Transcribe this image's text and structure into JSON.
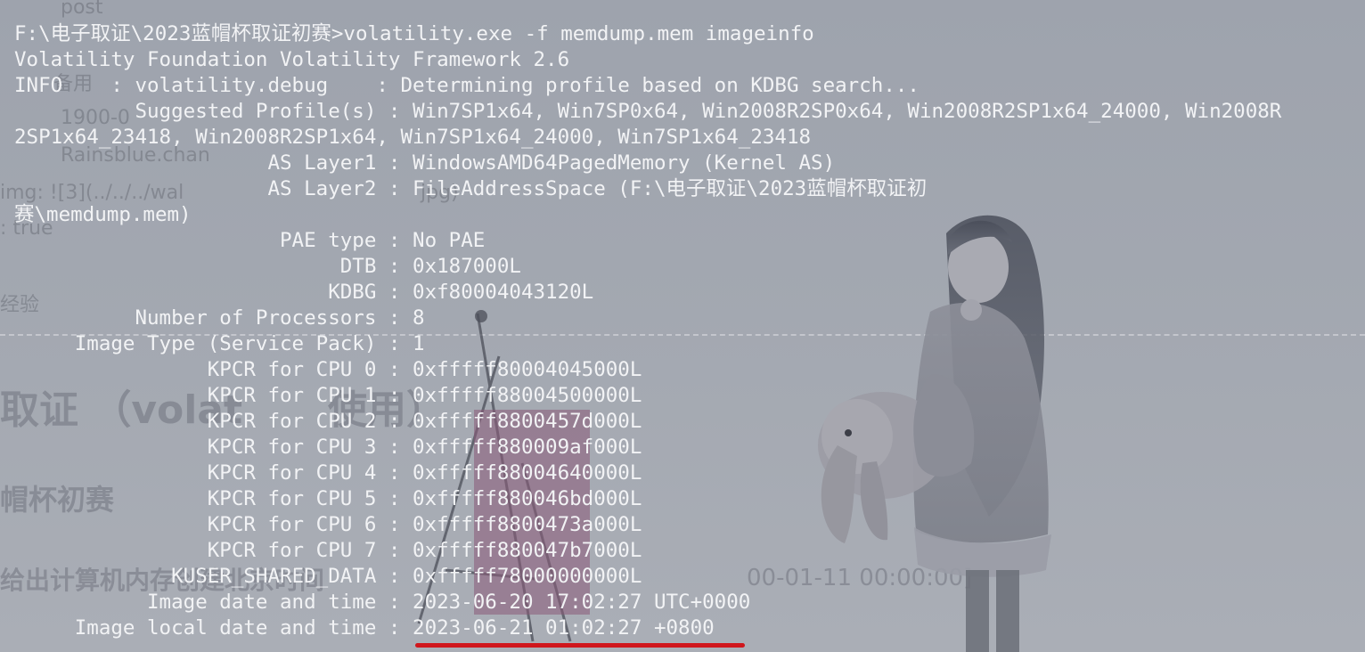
{
  "background": {
    "ghost_texts": [
      {
        "id": "post",
        "text": "post"
      },
      {
        "id": "cat",
        "text": "备用"
      },
      {
        "id": "date",
        "text": "1900-0"
      },
      {
        "id": "author",
        "text": "Rainsblue.chan"
      },
      {
        "id": "img",
        "text": "img: ![3](../../../wal"
      },
      {
        "id": "jpg",
        "text": "jpg)"
      },
      {
        "id": "bool",
        "text": ": true"
      },
      {
        "id": "exp",
        "text": "经验"
      },
      {
        "id": "heading1",
        "text": "取证 （volat"
      },
      {
        "id": "heading1b",
        "text": "使用）"
      },
      {
        "id": "heading2",
        "text": "帽杯初赛"
      },
      {
        "id": "question",
        "text": "给出计算机内存创建北京时间"
      },
      {
        "id": "qtail",
        "text": "00-01-11 00:00:00]"
      }
    ],
    "accent_color": "#d0161c"
  },
  "terminal": {
    "text_color": "#f2f3f5",
    "lines": [
      "F:\\电子取证\\2023蓝帽杯取证初赛>volatility.exe -f memdump.mem imageinfo",
      "Volatility Foundation Volatility Framework 2.6",
      "INFO    : volatility.debug    : Determining profile based on KDBG search...",
      "          Suggested Profile(s) : Win7SP1x64, Win7SP0x64, Win2008R2SP0x64, Win2008R2SP1x64_24000, Win2008R",
      "2SP1x64_23418, Win2008R2SP1x64, Win7SP1x64_24000, Win7SP1x64_23418",
      "                     AS Layer1 : WindowsAMD64PagedMemory (Kernel AS)",
      "                     AS Layer2 : FileAddressSpace (F:\\电子取证\\2023蓝帽杯取证初",
      "赛\\memdump.mem)",
      "                      PAE type : No PAE",
      "                           DTB : 0x187000L",
      "                          KDBG : 0xf80004043120L",
      "          Number of Processors : 8",
      "     Image Type (Service Pack) : 1",
      "                KPCR for CPU 0 : 0xfffff80004045000L",
      "                KPCR for CPU 1 : 0xfffff88004500000L",
      "                KPCR for CPU 2 : 0xfffff8800457d000L",
      "                KPCR for CPU 3 : 0xfffff880009af000L",
      "                KPCR for CPU 4 : 0xfffff88004640000L",
      "                KPCR for CPU 5 : 0xfffff880046bd000L",
      "                KPCR for CPU 6 : 0xfffff8800473a000L",
      "                KPCR for CPU 7 : 0xfffff880047b7000L",
      "             KUSER_SHARED_DATA : 0xfffff78000000000L",
      "           Image date and time : 2023-06-20 17:02:27 UTC+0000",
      "     Image local date and time : 2023-06-21 01:02:27 +0800"
    ]
  }
}
